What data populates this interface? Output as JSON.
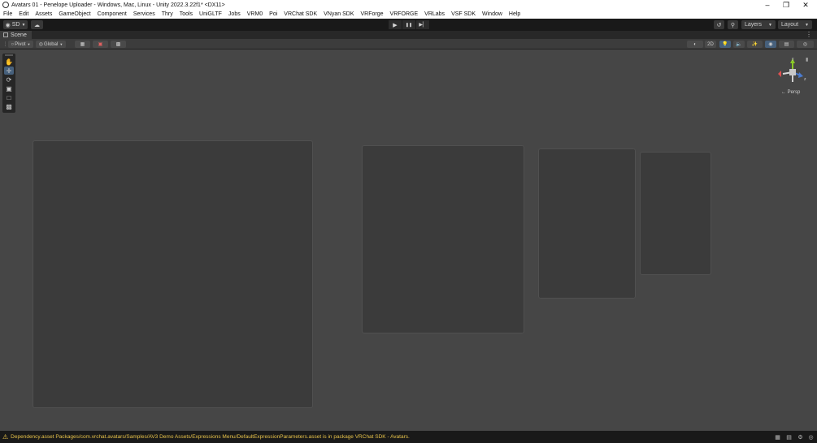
{
  "window": {
    "title": "Avatars 01 - Penelope Uploader - Windows, Mac, Linux - Unity 2022.3.22f1* <DX11>",
    "minimize_glyph": "–",
    "maximize_glyph": "❐",
    "close_glyph": "✕"
  },
  "menu": [
    "File",
    "Edit",
    "Assets",
    "GameObject",
    "Component",
    "Services",
    "Thry",
    "Tools",
    "UniGLTF",
    "Jobs",
    "VRM0",
    "Poi",
    "VRChat SDK",
    "VNyan SDK",
    "VRForge",
    "VRFORGE",
    "VRLabs",
    "VSF SDK",
    "Window",
    "Help"
  ],
  "toolbar": {
    "account_label": "SD",
    "layers_label": "Layers",
    "layout_label": "Layout",
    "play_glyph": "▶",
    "pause_glyph": "❚❚",
    "step_glyph": "▶▏",
    "history_icon": "history-icon",
    "search_icon": "search-icon"
  },
  "scene_tab": {
    "label": "Scene",
    "menu_glyph": "⋮"
  },
  "scene_toolbar": {
    "pivot_label": "Pivot",
    "global_label": "Global",
    "mode_2d_label": "2D"
  },
  "tools": [
    "hand-tool",
    "move-tool",
    "rotate-tool",
    "scale-tool",
    "rect-tool",
    "transform-tool"
  ],
  "gizmo": {
    "label": "← Persp",
    "axis_y": "y",
    "axis_z": "z",
    "lock_glyph": "▮"
  },
  "status": {
    "message": "Dependency.asset Packages/com.vrchat.avatars/Samples/AV3 Demo Assets/Expressions Menu/DefaultExpressionParameters.asset is in package VRChat SDK - Avatars."
  },
  "colors": {
    "viewport_bg": "#464646",
    "toolbar_bg": "#191919",
    "accent": "#46607c",
    "warning": "#e8c34a"
  }
}
